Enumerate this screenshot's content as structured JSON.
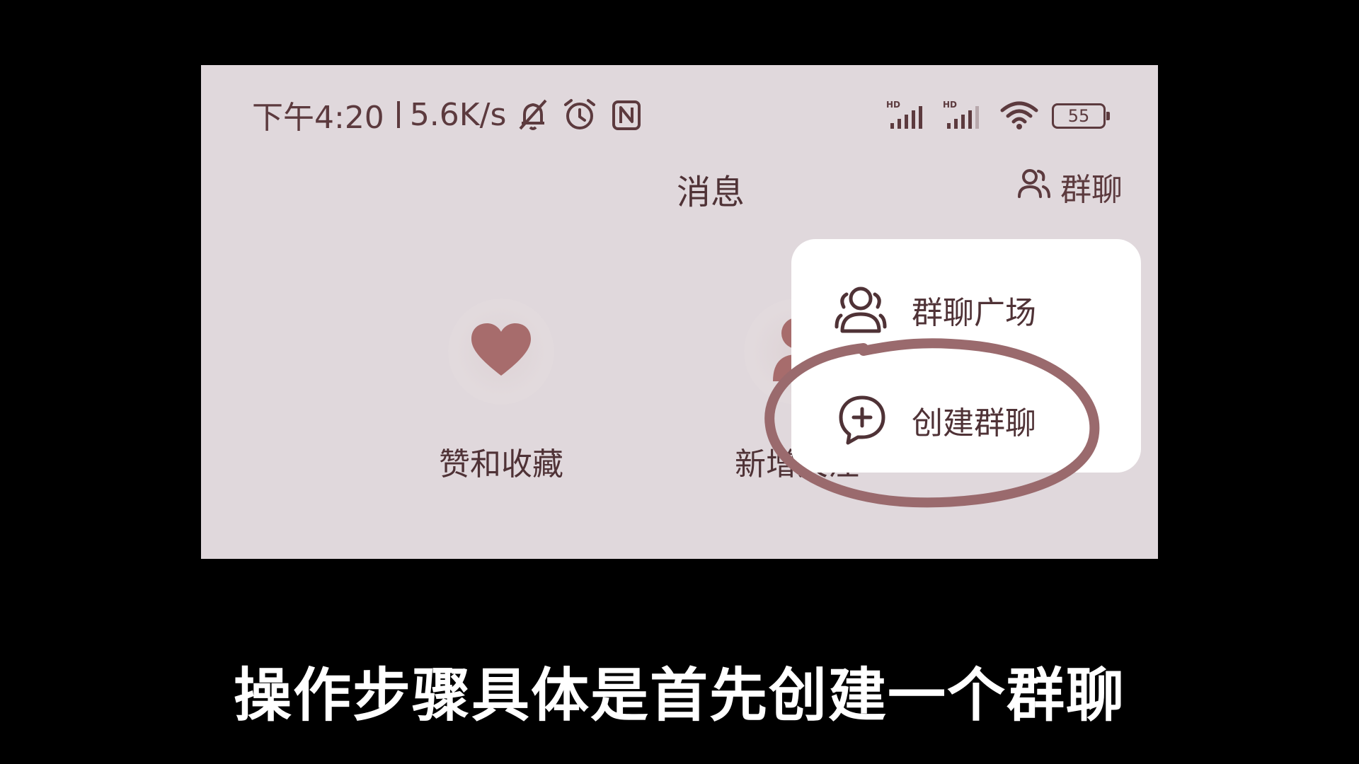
{
  "status_bar": {
    "time": "下午4:20",
    "network_speed": "5.6K/s",
    "battery_level": "55",
    "icons": [
      "mute-bell-icon",
      "alarm-icon",
      "nfc-icon",
      "hd-signal-icon",
      "hd-signal-icon",
      "wifi-icon",
      "battery-icon"
    ]
  },
  "header": {
    "title": "消息",
    "group_chat_label": "群聊"
  },
  "shortcuts": [
    {
      "label": "赞和收藏",
      "icon": "heart-icon"
    },
    {
      "label": "新增关注",
      "icon": "person-icon"
    }
  ],
  "dropdown": {
    "items": [
      {
        "label": "群聊广场",
        "icon": "group-icon"
      },
      {
        "label": "创建群聊",
        "icon": "add-chat-icon"
      }
    ]
  },
  "subtitle": "操作步骤具体是首先创建一个群聊",
  "colors": {
    "background": "#000000",
    "screen": "#e0d8dc",
    "accent": "#a76c6c",
    "text": "#4f3236",
    "highlight_circle": "#9a6a6d"
  }
}
